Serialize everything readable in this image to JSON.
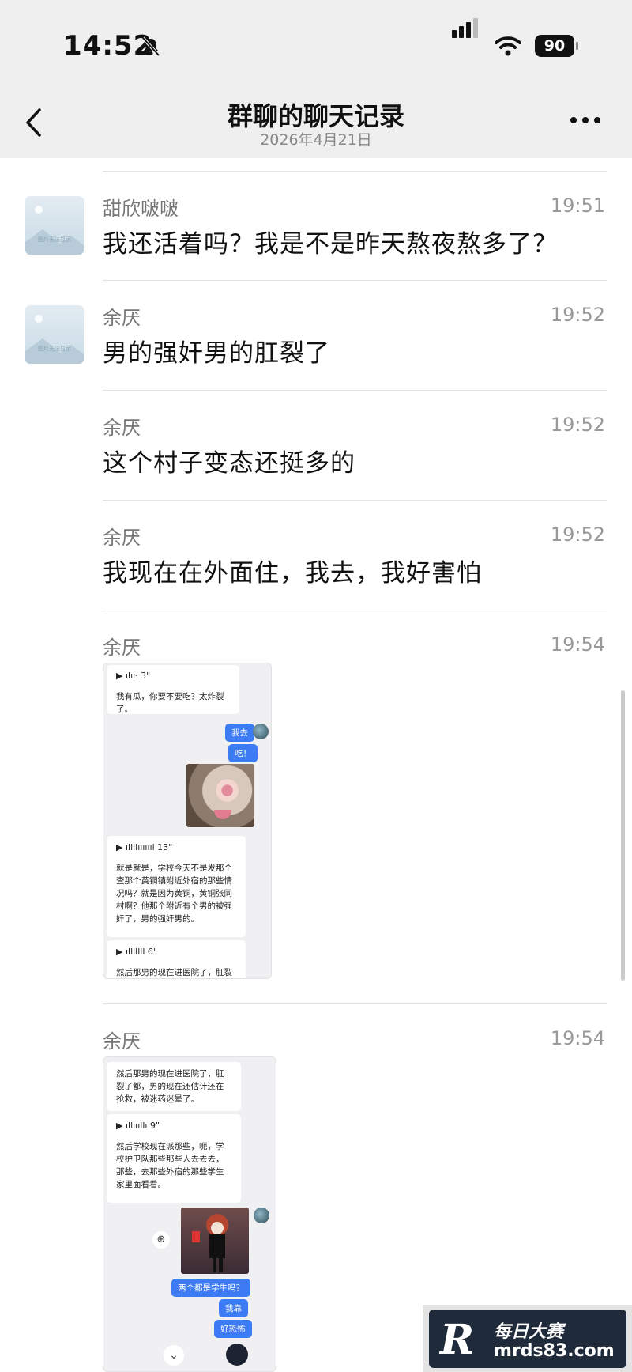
{
  "status_bar": {
    "time": "14:52",
    "battery": "90"
  },
  "nav": {
    "title": "群聊的聊天记录",
    "subtitle": "2026年4月21日"
  },
  "avatar_caption": "图片无法显示",
  "messages": [
    {
      "sender": "甜欣啵啵",
      "time": "19:51",
      "text": "我还活着吗？我是不是昨天熬夜熬多了？"
    },
    {
      "sender": "余厌",
      "time": "19:52",
      "text": "男的强奸男的肛裂了"
    },
    {
      "sender": "余厌",
      "time": "19:52",
      "text": "这个村子变态还挺多的"
    },
    {
      "sender": "余厌",
      "time": "19:52",
      "text": "我现在在外面住，我去，我好害怕"
    },
    {
      "sender": "余厌",
      "time": "19:54"
    },
    {
      "sender": "余厌",
      "time": "19:54"
    }
  ],
  "shot1": {
    "voice1": "▶ ılıı· 3\"",
    "text1": "我有瓜，你要不要吃？太炸裂了。",
    "reply1": "我去",
    "reply2": "吃！",
    "voice2": "▶ ıllllııııııl 13\"",
    "text2": "就是就是，学校今天不是发那个查那个黄铜镇附近外宿的那些情况吗？就是因为黄铜，黄铜张同村啊？他那个附近有个男的被强奸了，男的强奸男的。",
    "voice3": "▶ ılllllll 6\"",
    "text3": "然后那男的现在进医院了，肛裂"
  },
  "shot2": {
    "text1": "然后那男的现在进医院了，肛裂了都，男的现在还估计还在抢救，被迷药迷晕了。",
    "voice": "▶ ıllıııllı 9\"",
    "text2": "然后学校现在派那些，呃，学校护卫队那些那些人去去去，那些，去那些外宿的那些学生家里面看看。",
    "reply1": "两个都是学生吗？",
    "reply2": "我靠",
    "reply3": "好恐怖"
  },
  "watermark": {
    "line1": "每日大赛",
    "line2": "mrds83.com",
    "logo": "R"
  }
}
